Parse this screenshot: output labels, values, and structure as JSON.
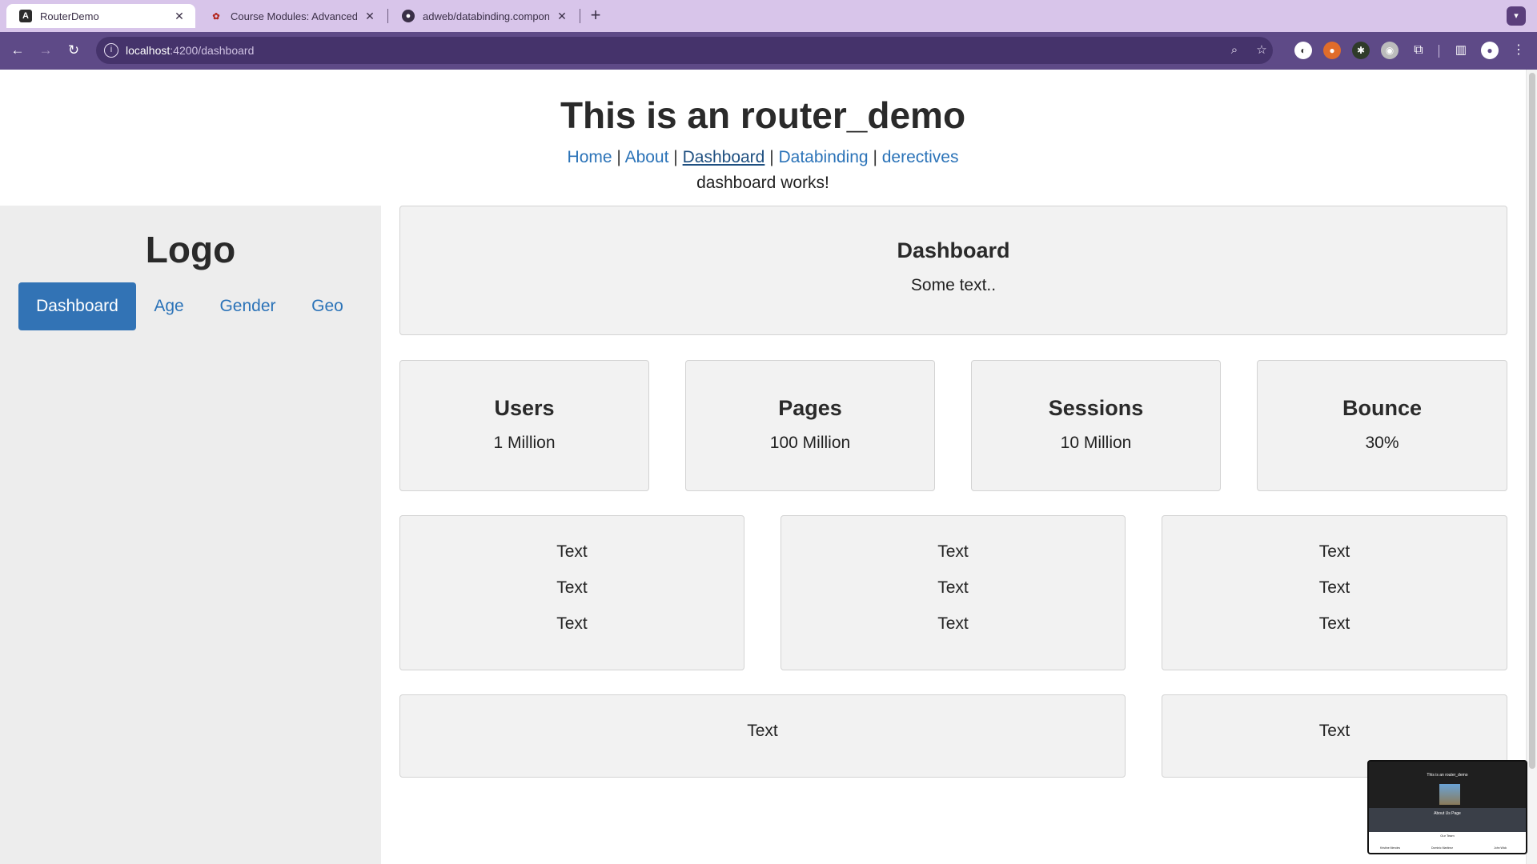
{
  "browser": {
    "tabs": [
      {
        "title": "RouterDemo",
        "active": true,
        "favicon": "angular-icon"
      },
      {
        "title": "Course Modules: Advanced D",
        "active": false,
        "favicon": "course-icon"
      },
      {
        "title": "adweb/databinding.compone",
        "active": false,
        "favicon": "github-icon"
      }
    ],
    "new_tab_label": "+",
    "url_host": "localhost",
    "url_path": ":4200/dashboard"
  },
  "page": {
    "title": "This is an router_demo",
    "nav": {
      "home": "Home",
      "about": "About",
      "dashboard": "Dashboard",
      "databinding": "Databinding",
      "derectives": "derectives",
      "separator": "|"
    },
    "works_text": "dashboard works!"
  },
  "sidebar": {
    "logo": "Logo",
    "tabs": [
      "Dashboard",
      "Age",
      "Gender",
      "Geo"
    ],
    "active_tab": "Dashboard"
  },
  "dashboard": {
    "header": {
      "title": "Dashboard",
      "subtitle": "Some text.."
    },
    "stats": [
      {
        "label": "Users",
        "value": "1 Million"
      },
      {
        "label": "Pages",
        "value": "100 Million"
      },
      {
        "label": "Sessions",
        "value": "10 Million"
      },
      {
        "label": "Bounce",
        "value": "30%"
      }
    ],
    "text_cards": [
      [
        "Text",
        "Text",
        "Text"
      ],
      [
        "Text",
        "Text",
        "Text"
      ],
      [
        "Text",
        "Text",
        "Text"
      ]
    ],
    "bottom_cards": [
      "Text",
      "Text"
    ]
  },
  "preview_thumbnail": {
    "title": "This is an router_demo",
    "section": "About Us Page",
    "team_heading": "Our Team",
    "members": [
      "Kristine Mendes",
      "Dominic Martinez",
      "John Wick"
    ]
  },
  "colors": {
    "tabbar": "#d8c5ea",
    "toolbar": "#5e4a87",
    "link": "#2b73b8",
    "active_tab_bg": "#3273b5",
    "sidebar_bg": "#ededed",
    "card_bg": "#f2f2f2"
  }
}
